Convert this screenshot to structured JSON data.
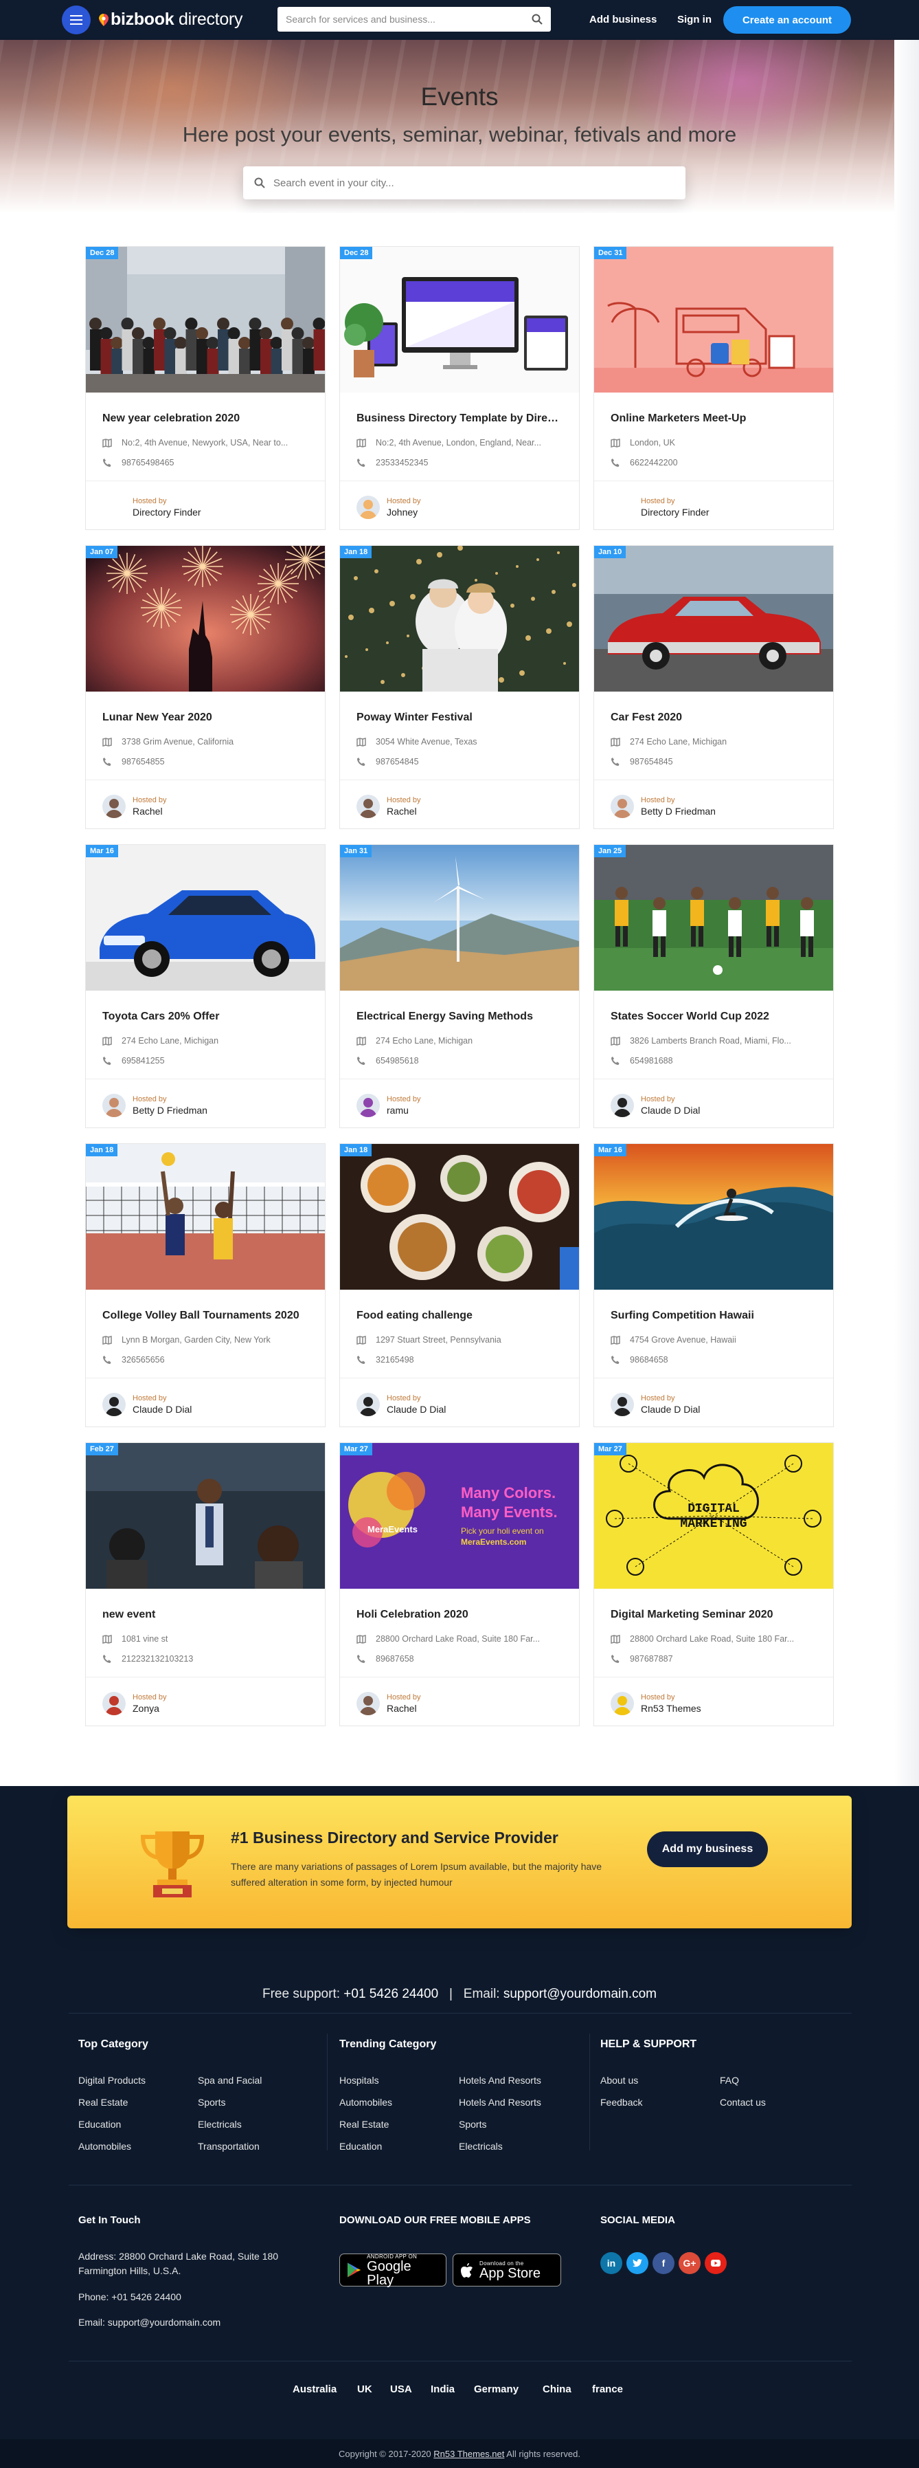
{
  "header": {
    "logo_bold": "bizbook",
    "logo_light": " directory",
    "search_placeholder": "Search for services and business...",
    "add_business": "Add business",
    "sign_in": "Sign in",
    "create_account": "Create an account"
  },
  "hero": {
    "title": "Events",
    "subtitle": "Here post your events, seminar, webinar, fetivals and more",
    "search_placeholder": "Search event in your city..."
  },
  "events": [
    {
      "date": "Dec 28",
      "title": "New year celebration 2020",
      "address": "No:2, 4th Avenue,  Newyork, USA, Near to...",
      "phone": "98765498465",
      "hosted_label": "Hosted by",
      "host": "Directory Finder",
      "image": "crowd-photo"
    },
    {
      "date": "Dec 28",
      "title": "Business Directory Template by Directory Finder",
      "address": "No:2, 4th Avenue,  London, England, Near...",
      "phone": "23533452345",
      "hosted_label": "Hosted by",
      "host": "Johney",
      "image": "devices-mockup"
    },
    {
      "date": "Dec 31",
      "title": "Online Marketers Meet-Up",
      "address": "London, UK",
      "phone": "6622442200",
      "hosted_label": "Hosted by",
      "host": "Directory Finder",
      "image": "van-illustration"
    },
    {
      "date": "Jan 07",
      "title": "Lunar New Year 2020",
      "address": "3738  Grim Avenue, California",
      "phone": "987654855",
      "hosted_label": "Hosted by",
      "host": "Rachel",
      "image": "fireworks"
    },
    {
      "date": "Jan 18",
      "title": "Poway Winter Festival",
      "address": "3054  White Avenue, Texas",
      "phone": "987654845",
      "hosted_label": "Hosted by",
      "host": "Rachel",
      "image": "winter-couple"
    },
    {
      "date": "Jan 10",
      "title": "Car Fest 2020",
      "address": "274  Echo Lane, Michigan",
      "phone": "987654845",
      "hosted_label": "Hosted by",
      "host": "Betty D Friedman",
      "image": "red-classic-car"
    },
    {
      "date": "Mar 16",
      "title": "Toyota Cars 20% Offer",
      "address": "274  Echo Lane, Michigan",
      "phone": "695841255",
      "hosted_label": "Hosted by",
      "host": "Betty D Friedman",
      "image": "blue-car"
    },
    {
      "date": "Jan 31",
      "title": "Electrical Energy Saving Methods",
      "address": "274  Echo Lane, Michigan",
      "phone": "654985618",
      "hosted_label": "Hosted by",
      "host": "ramu",
      "image": "wind-turbine"
    },
    {
      "date": "Jan 25",
      "title": "States Soccer World Cup 2022",
      "address": "3826  Lamberts Branch Road, Miami, Flo...",
      "phone": "654981688",
      "hosted_label": "Hosted by",
      "host": "Claude D Dial",
      "image": "soccer-players"
    },
    {
      "date": "Jan 18",
      "title": "College Volley Ball Tournaments 2020",
      "address": "Lynn B Morgan, Garden City, New York",
      "phone": "326565656",
      "hosted_label": "Hosted by",
      "host": "Claude D Dial",
      "image": "volleyball"
    },
    {
      "date": "Jan 18",
      "title": "Food eating challenge",
      "address": "1297  Stuart Street, Pennsylvania",
      "phone": "32165498",
      "hosted_label": "Hosted by",
      "host": "Claude D Dial",
      "image": "food-table"
    },
    {
      "date": "Mar 16",
      "title": "Surfing Competition Hawaii",
      "address": "4754  Grove Avenue, Hawaii",
      "phone": "98684658",
      "hosted_label": "Hosted by",
      "host": "Claude D Dial",
      "image": "surfer"
    },
    {
      "date": "Feb 27",
      "title": "new event",
      "address": "1081 vine st",
      "phone": "212232132103213",
      "hosted_label": "Hosted by",
      "host": "Zonya",
      "image": "presentation"
    },
    {
      "date": "Mar 27",
      "title": "Holi Celebration 2020",
      "address": "28800 Orchard Lake Road, Suite 180 Far...",
      "phone": "89687658",
      "hosted_label": "Hosted by",
      "host": "Rachel",
      "image": "holi-banner"
    },
    {
      "date": "Mar 27",
      "title": "Digital Marketing Seminar 2020",
      "address": "28800 Orchard Lake Road, Suite 180 Far...",
      "phone": "987687887",
      "hosted_label": "Hosted by",
      "host": "Rn53 Themes",
      "image": "digital-marketing"
    }
  ],
  "holi_banner": {
    "brand": "MeraEvents",
    "line1": "Many Colors.",
    "line2": "Many Events.",
    "line3": "Pick your holi event on",
    "line4": "MeraEvents.com"
  },
  "dm_banner": {
    "title1": "DIGITAL",
    "title2": "MARKETING"
  },
  "promo": {
    "title": "#1 Business Directory and Service Provider",
    "text": "There are many variations of passages of Lorem Ipsum available, but the majority have suffered alteration in some form, by injected humour",
    "button": "Add my business"
  },
  "footer": {
    "support_label": "Free support:",
    "support_phone": "+01 5426 24400",
    "email_label": "Email:",
    "support_email": "support@yourdomain.com",
    "top_category": {
      "heading": "Top Category",
      "col1": [
        "Digital Products",
        "Real Estate",
        "Education",
        "Automobiles"
      ],
      "col2": [
        "Spa and Facial",
        "Sports",
        "Electricals",
        "Transportation"
      ]
    },
    "trending_category": {
      "heading": "Trending Category",
      "col1": [
        "Hospitals",
        "Automobiles",
        "Real Estate",
        "Education"
      ],
      "col2": [
        "Hotels And Resorts",
        "Hotels And Resorts",
        "Sports",
        "Electricals"
      ]
    },
    "help": {
      "heading": "HELP & SUPPORT",
      "col1": [
        "About us",
        "Feedback"
      ],
      "col2": [
        "FAQ",
        "Contact us"
      ]
    },
    "get_in_touch": {
      "heading": "Get In Touch",
      "address_line1": "Address: 28800 Orchard Lake Road, Suite 180",
      "address_line2": "Farmington Hills, U.S.A.",
      "phone": "Phone: +01 5426 24400",
      "email": "Email: support@yourdomain.com"
    },
    "apps": {
      "heading": "DOWNLOAD OUR FREE MOBILE APPS",
      "google_small": "ANDROID APP ON",
      "google_big": "Google Play",
      "apple_small": "Download on the",
      "apple_big": "App Store"
    },
    "social": {
      "heading": "SOCIAL MEDIA",
      "icons": [
        "linkedin-icon",
        "twitter-icon",
        "facebook-icon",
        "google-plus-icon",
        "youtube-icon"
      ],
      "colors": [
        "#0e76a8",
        "#1da1f2",
        "#3b5998",
        "#dd4b39",
        "#e62117"
      ]
    },
    "countries": [
      "Australia",
      "UK",
      "USA",
      "India",
      "Germany",
      "China",
      "france"
    ],
    "copyright_pre": "Copyright © 2017-2020 ",
    "copyright_link": "Rn53 Themes.net",
    "copyright_post": " All rights reserved."
  },
  "colors": {
    "accent": "#1e8ff0",
    "date_badge": "#2e9bf5",
    "nav": "#0f1b2e",
    "footer": "#0e1a2c",
    "promo": "#fbcb45"
  }
}
